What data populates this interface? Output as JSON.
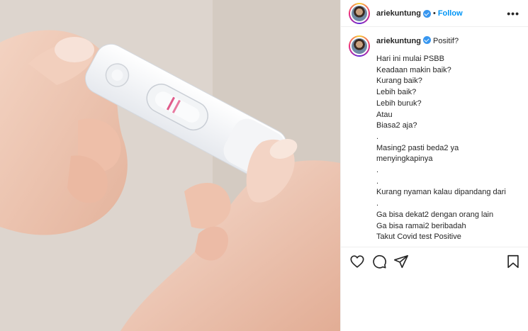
{
  "post": {
    "author": {
      "username": "ariekuntung",
      "verified": true
    },
    "follow_label": "Follow",
    "separator": "•",
    "more_label": "•••",
    "caption_title": "Positif?",
    "caption_lines": [
      "Hari ini mulai PSBB",
      "Keadaan makin baik?",
      "Kurang baik?",
      "Lebih baik?",
      "Lebih buruk?",
      "Atau",
      "Biasa2 aja?",
      ".",
      "Masing2 pasti beda2 ya",
      "menyingkapinya",
      ".",
      ".",
      "Kurang nyaman kalau dipandang dari",
      ".",
      "Ga bisa dekat2 dengan orang lain",
      "Ga bisa ramai2 beribadah",
      "Takut Covid test Positive"
    ]
  },
  "actions": {
    "like_icon": "heart-icon",
    "comment_icon": "comment-icon",
    "share_icon": "paper-plane-icon",
    "save_icon": "bookmark-icon"
  },
  "colors": {
    "link": "#0095f6",
    "verified": "#3897f0",
    "text": "#262626",
    "border": "#efefef"
  }
}
